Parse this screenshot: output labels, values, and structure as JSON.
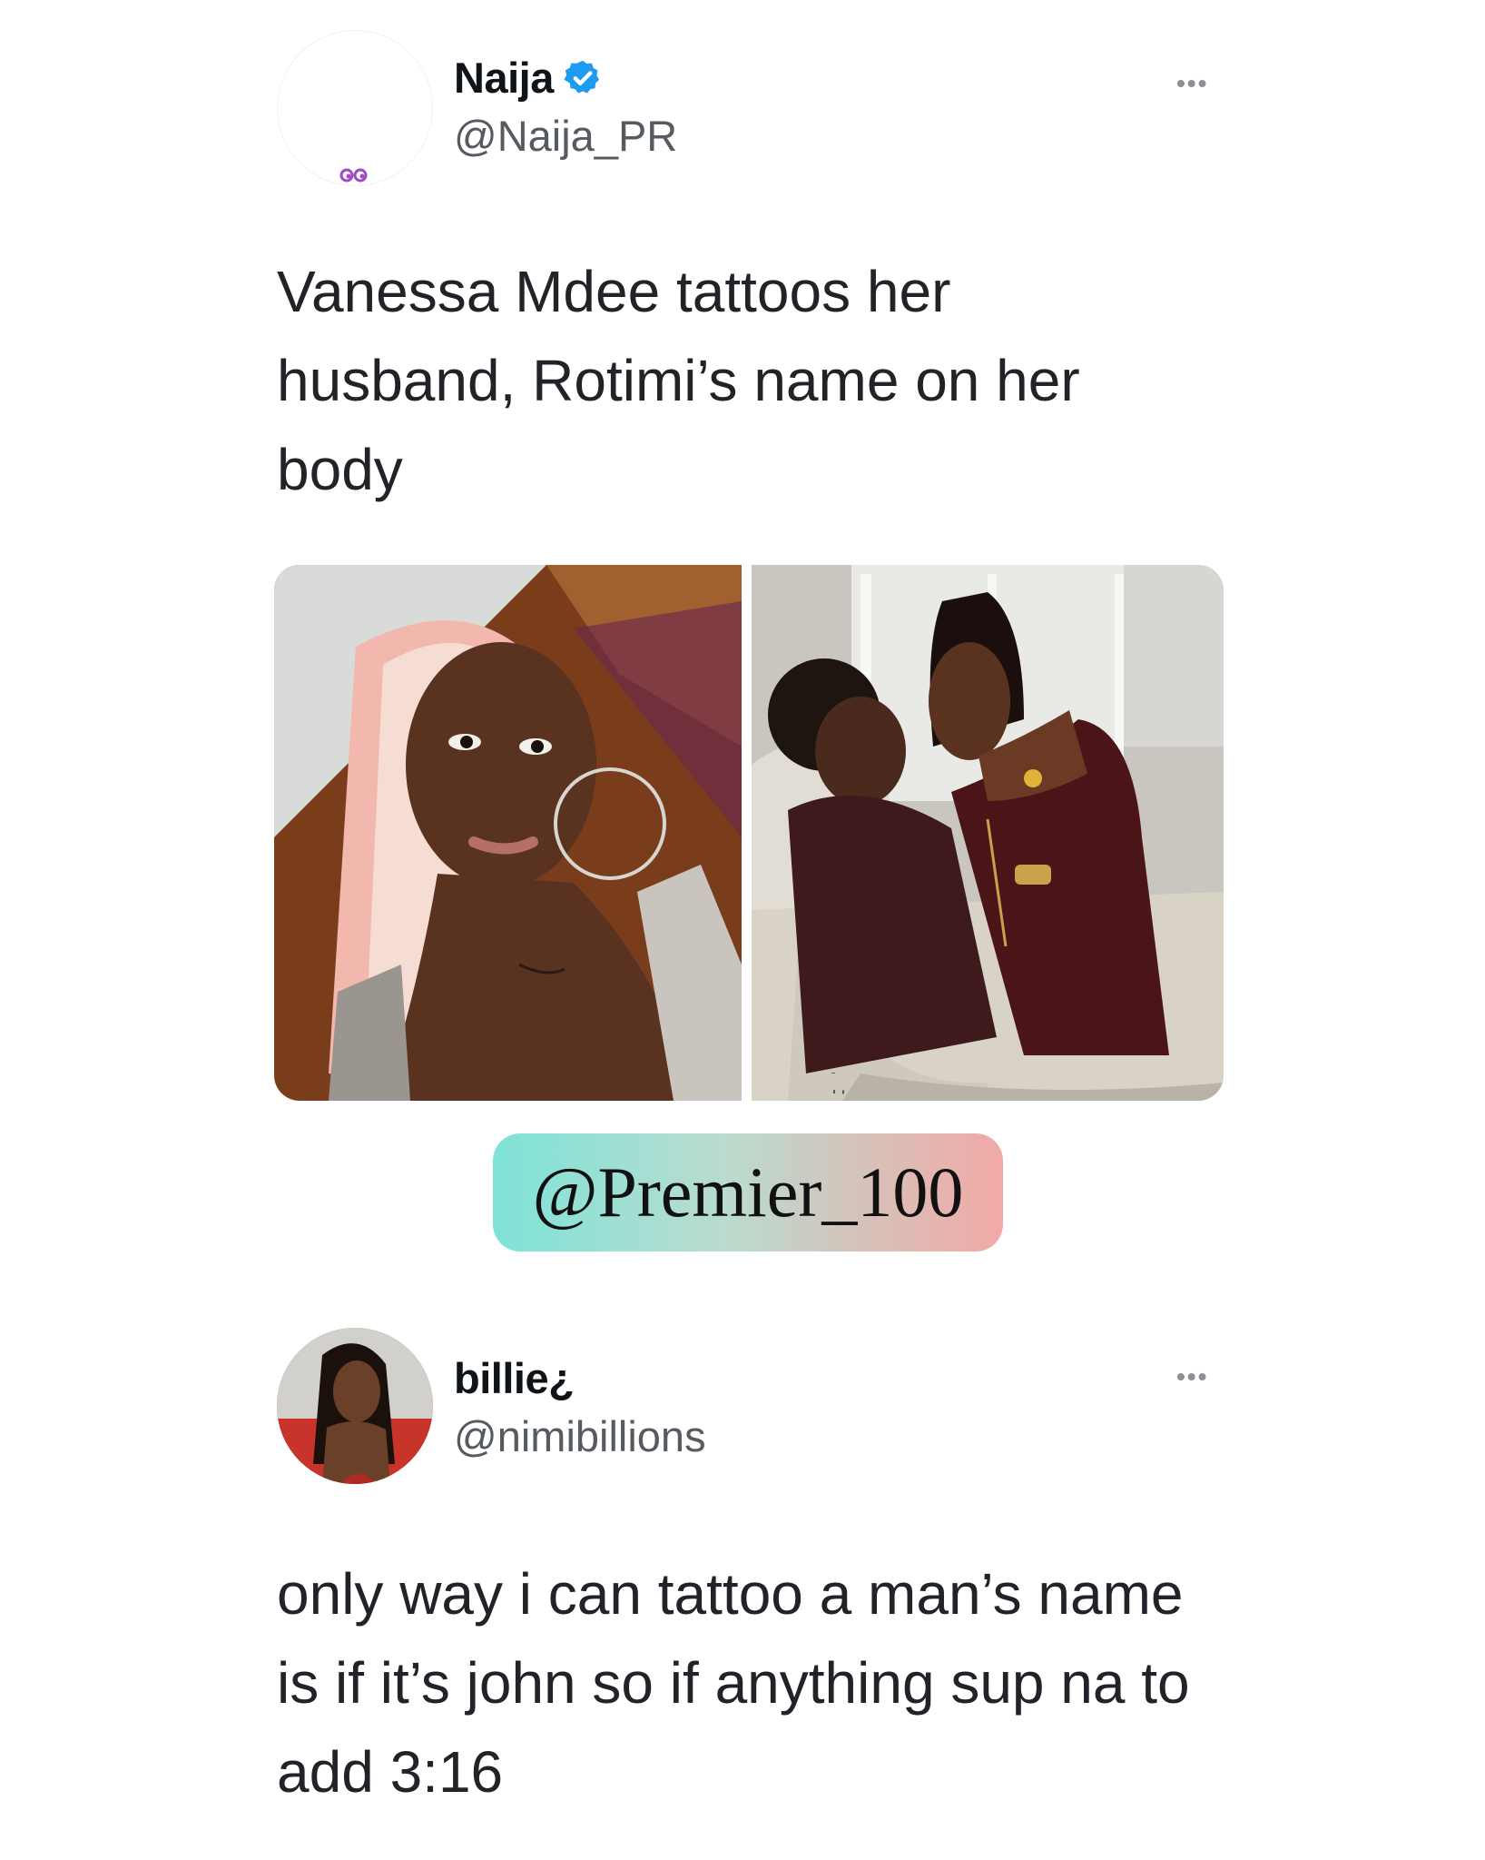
{
  "tweet1": {
    "display_name": "Naija",
    "handle": "@Naija_PR",
    "verified_icon": "verified-badge-icon",
    "more_icon": "more-options-icon",
    "text_lines": [
      "Vanessa Mdee tattoos her",
      "husband, Rotimi’s name on her",
      "body"
    ],
    "media": [
      "woman-selfie-photo",
      "couple-photo"
    ]
  },
  "watermark": {
    "text": "@Premier_100"
  },
  "tweet2": {
    "display_name": "billie¿",
    "handle": "@nimibillions",
    "more_icon": "more-options-icon",
    "text_lines": [
      "only way i can tattoo a man’s name",
      "is if it’s john so if anything sup na to",
      "add 3:16"
    ]
  },
  "colors": {
    "verified_blue": "#1d9bf0",
    "handle_gray": "#555b60",
    "watermark_start": "#7fe3d8",
    "watermark_end": "#f2a9a6"
  }
}
